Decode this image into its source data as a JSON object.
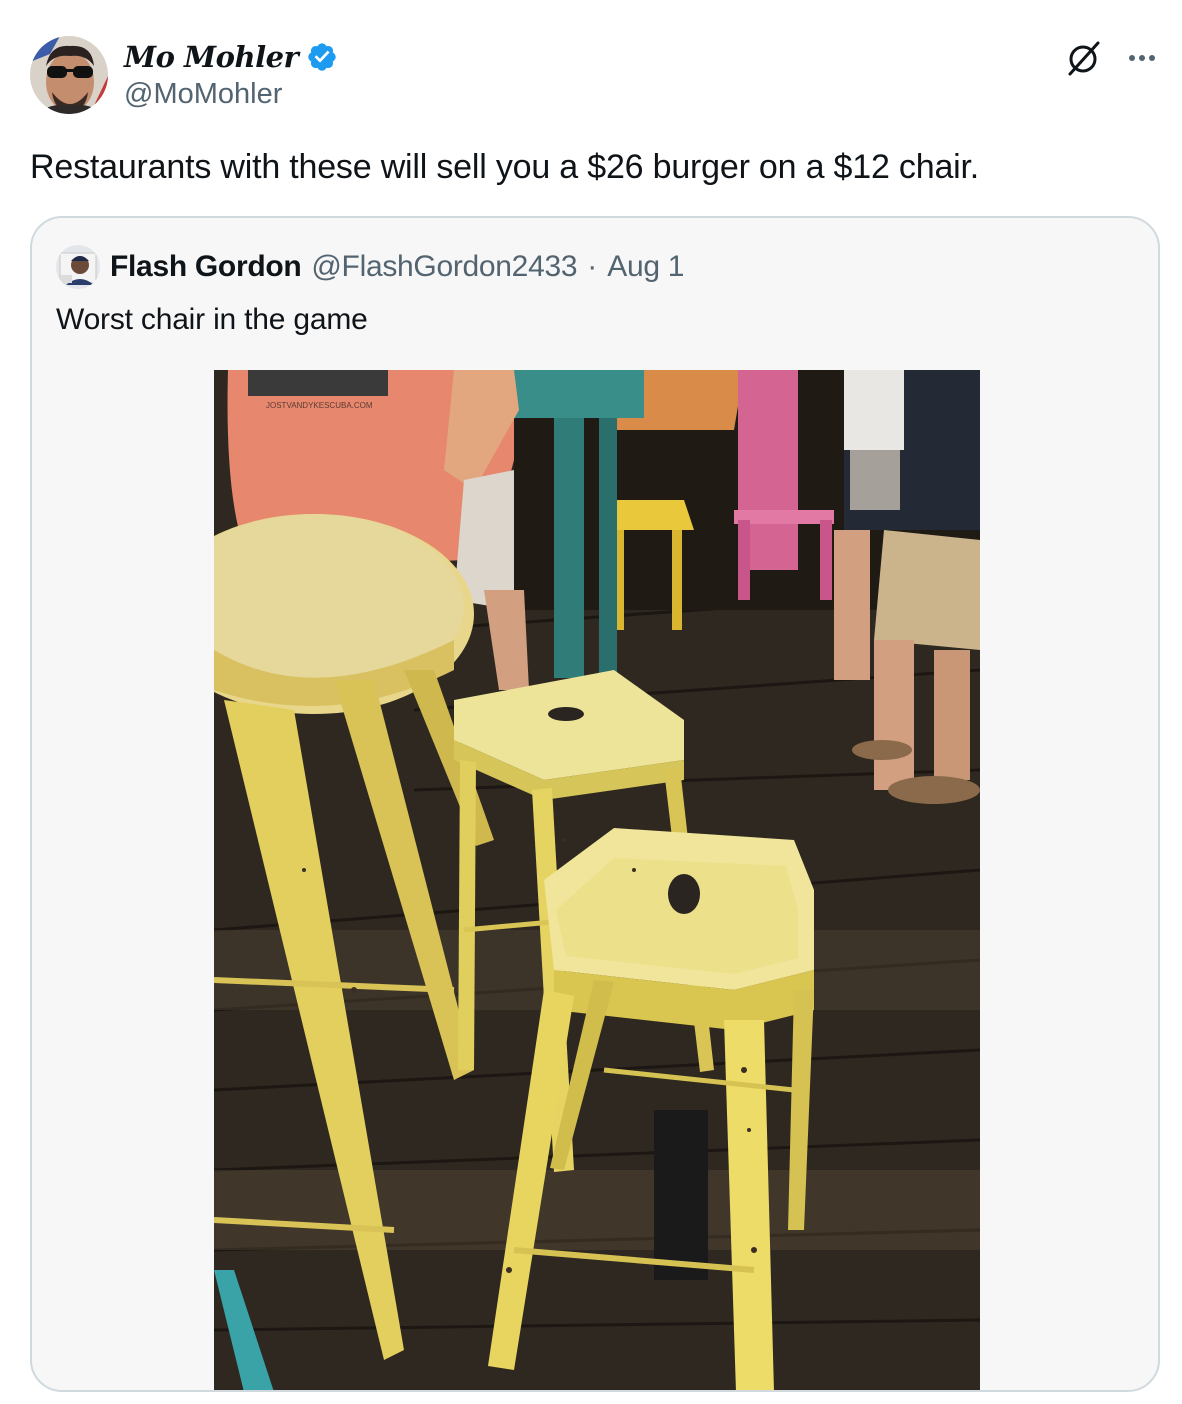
{
  "tweet": {
    "author": {
      "display_name": "Mo Mohler",
      "handle": "@MoMohler",
      "verified": true,
      "avatar_icon": "avatar-photo"
    },
    "text": "Restaurants with these will sell you a $26 burger on a $12 chair.",
    "actions": {
      "grok_icon": "grok-icon",
      "more_icon": "more-options-icon"
    }
  },
  "quoted_tweet": {
    "author": {
      "display_name": "Flash Gordon",
      "handle": "@FlashGordon2433",
      "avatar_icon": "avatar-photo"
    },
    "separator": "·",
    "date": "Aug 1",
    "text": "Worst chair in the game",
    "media": {
      "type": "photo",
      "shirt_print": "JOSTVANDYKESCUBA.COM"
    }
  },
  "colors": {
    "text_primary": "#0f1419",
    "text_secondary": "#536471",
    "verified_blue": "#1d9bf0",
    "card_border": "#cfd9de",
    "card_bg": "#f7f7f7"
  }
}
